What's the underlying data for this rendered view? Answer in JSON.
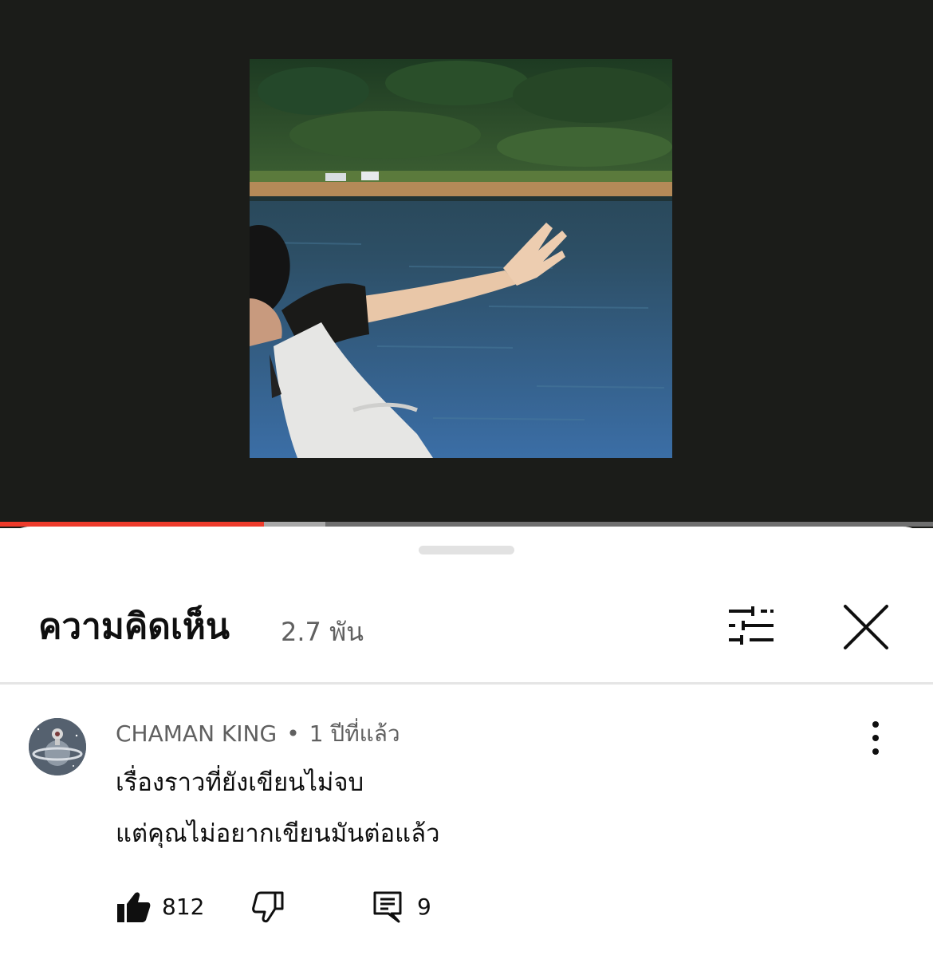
{
  "player": {
    "progress_played": 0.283,
    "progress_buffered": 0.349,
    "colors": {
      "played": "#ee3b2b",
      "buffered": "#a8a8a8",
      "track": "#6f6f6f",
      "background": "#1b1c19"
    }
  },
  "comments_panel": {
    "title": "ความคิดเห็น",
    "count": "2.7 พัน",
    "filter_icon": "sort-filter-icon",
    "close_icon": "close-icon"
  },
  "comments": [
    {
      "author": "CHAMAN KING",
      "separator": "•",
      "time": "1 ปีที่แล้ว",
      "text_line1": "เรื่องราวที่ยังเขียนไม่จบ",
      "text_line2": "แต่คุณไม่อยากเขียนมันต่อแล้ว",
      "likes": "812",
      "replies": "9",
      "icons": {
        "like": "thumbs-up-icon",
        "dislike": "thumbs-down-icon",
        "reply": "reply-icon",
        "more": "more-vertical-icon"
      }
    }
  ]
}
